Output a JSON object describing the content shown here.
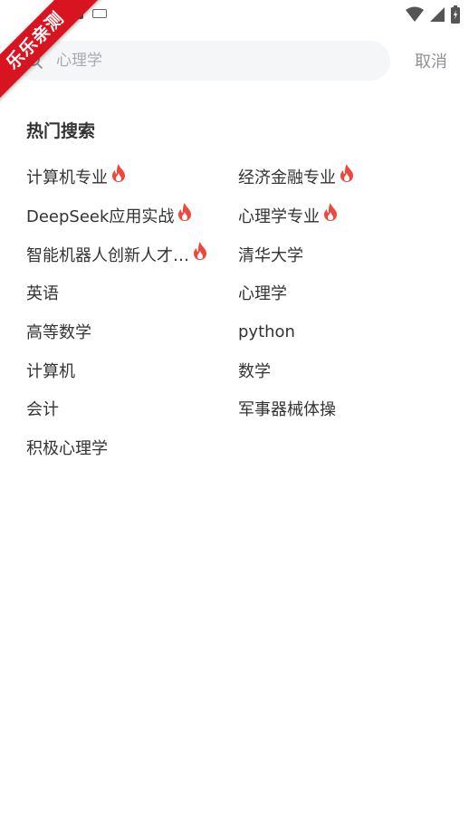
{
  "ribbon": {
    "text": "乐乐亲测"
  },
  "search": {
    "placeholder": "心理学",
    "value": "",
    "cancel_label": "取消"
  },
  "hot": {
    "title": "热门搜索",
    "items": [
      {
        "label": "计算机专业",
        "hot": true
      },
      {
        "label": "经济金融专业",
        "hot": true
      },
      {
        "label": "DeepSeek应用实战",
        "hot": true
      },
      {
        "label": "心理学专业",
        "hot": true
      },
      {
        "label": "智能机器人创新人才…",
        "hot": true
      },
      {
        "label": "清华大学",
        "hot": false
      },
      {
        "label": "英语",
        "hot": false
      },
      {
        "label": "心理学",
        "hot": false
      },
      {
        "label": "高等数学",
        "hot": false
      },
      {
        "label": "python",
        "hot": false
      },
      {
        "label": "计算机",
        "hot": false
      },
      {
        "label": "数学",
        "hot": false
      },
      {
        "label": "会计",
        "hot": false
      },
      {
        "label": "军事器械体操",
        "hot": false
      },
      {
        "label": "积极心理学",
        "hot": false
      }
    ]
  },
  "colors": {
    "flame": "#f0473a",
    "ribbon": "#d71420",
    "search_bg": "#f5f6f8",
    "muted_text": "#8e9096"
  }
}
